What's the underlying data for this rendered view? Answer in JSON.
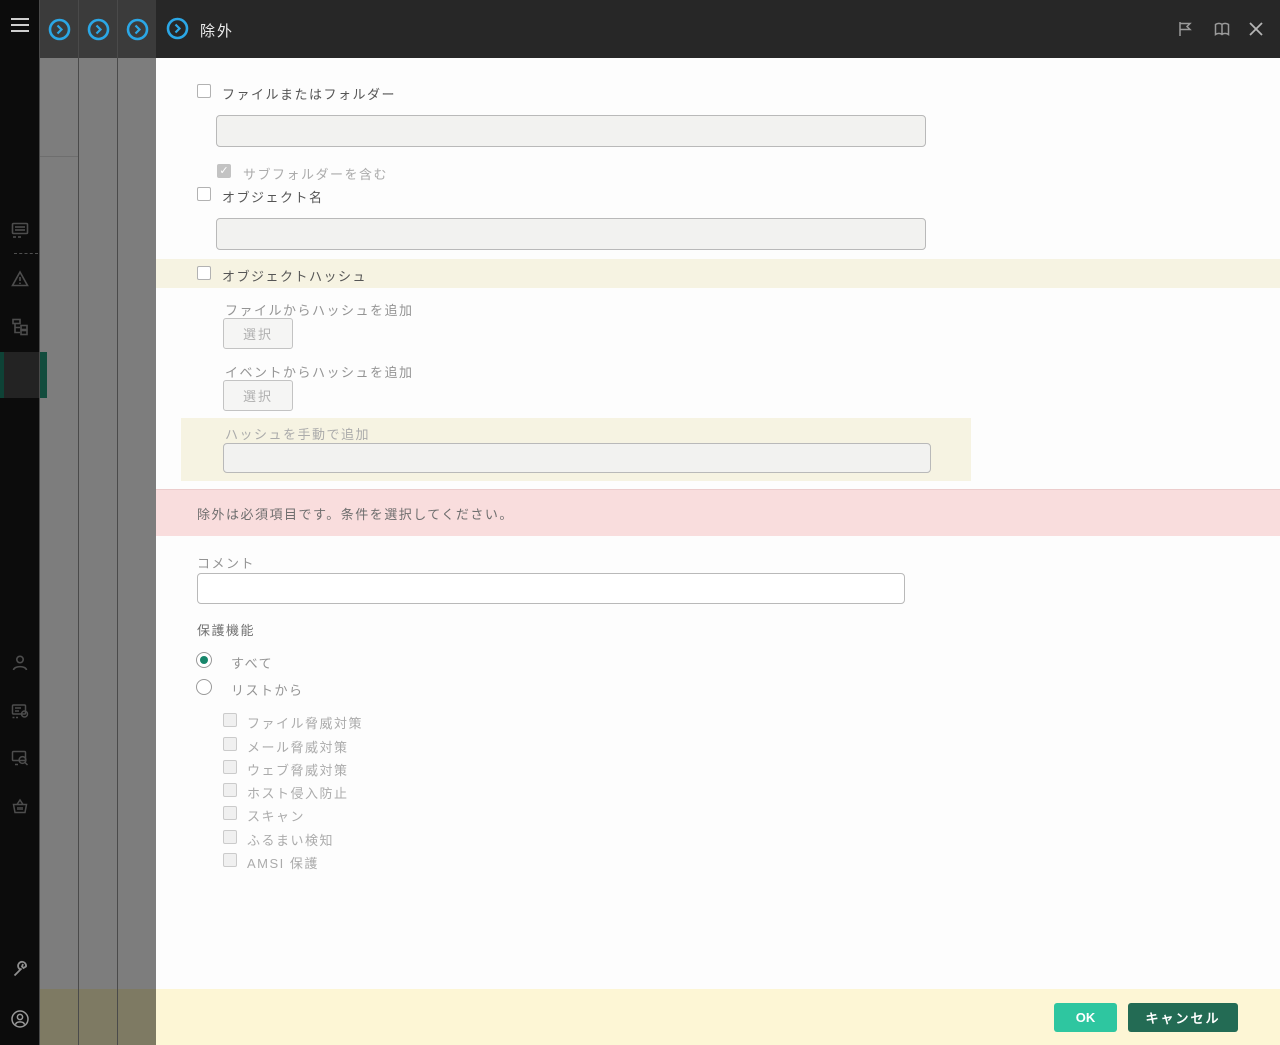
{
  "colors": {
    "accent_blue": "#2ba7e6",
    "accent_teal": "#17866b",
    "ok_button": "#2ec6a0",
    "cancel_button": "#236b54",
    "footer_bg": "#fdf6d5",
    "highlight_cream": "#f6f3e2",
    "error_pink": "#f9dddd",
    "titlebar_bg": "#272727"
  },
  "icons": {
    "close_glyph": "✕",
    "check_glyph": "✓"
  },
  "titlebar": {
    "title": "除外"
  },
  "dialog": {
    "file_folder": {
      "label": "ファイルまたはフォルダー",
      "checked": false,
      "value": "",
      "include_subfolders_label": "サブフォルダーを含む",
      "include_subfolders_checked": true
    },
    "object_name": {
      "label": "オブジェクト名",
      "checked": false,
      "value": ""
    },
    "object_hash": {
      "label": "オブジェクトハッシュ",
      "checked": false,
      "from_file_label": "ファイルからハッシュを追加",
      "from_event_label": "イベントからハッシュを追加",
      "select_button": "選択",
      "manual_label": "ハッシュを手動で追加",
      "manual_value": ""
    },
    "error_message": "除外は必須項目です。条件を選択してください。",
    "comment": {
      "label": "コメント",
      "value": ""
    },
    "protection": {
      "label": "保護機能",
      "selected_option": "すべて",
      "all_option": "すべて",
      "from_list_option": "リストから",
      "items": [
        "ファイル脅威対策",
        "メール脅威対策",
        "ウェブ脅威対策",
        "ホスト侵入防止",
        "スキャン",
        "ふるまい検知",
        "AMSI 保護"
      ]
    },
    "footer": {
      "ok": "OK",
      "cancel": "キャンセル"
    }
  }
}
